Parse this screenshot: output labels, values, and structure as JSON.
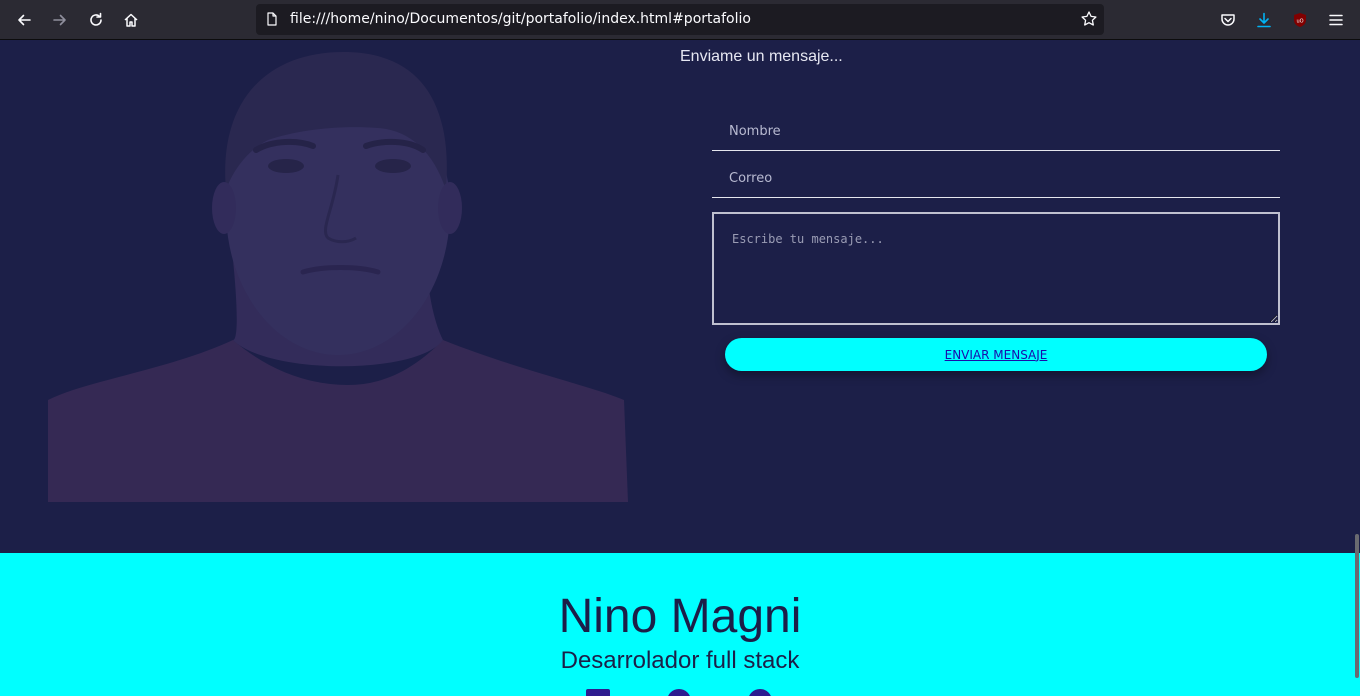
{
  "browser": {
    "url": "file:///home/nino/Documentos/git/portafolio/index.html#portafolio",
    "icons": [
      "back-icon",
      "forward-icon",
      "reload-icon",
      "home-icon",
      "page-icon",
      "bookmark-star-icon",
      "pocket-icon",
      "download-icon",
      "ublock-icon",
      "menu-icon"
    ],
    "colors": {
      "toolbar": "#2b2a33",
      "urlbar": "#1c1b22",
      "download_accent": "#00b3f4",
      "ublock": "#800000"
    }
  },
  "contact": {
    "heading": "Enviame un mensaje...",
    "name_placeholder": "Nombre",
    "email_placeholder": "Correo",
    "message_placeholder": "Escribe tu mensaje...",
    "send_label": "ENVIAR MENSAJE",
    "colors": {
      "background": "#1c1f48",
      "button": "#00ffff"
    }
  },
  "footer": {
    "name": "Nino Magni",
    "role": "Desarrolador full stack",
    "social_icons": [
      "social-icon",
      "social-icon",
      "social-icon"
    ],
    "colors": {
      "background": "#00ffff",
      "text": "#1c1f48"
    }
  }
}
